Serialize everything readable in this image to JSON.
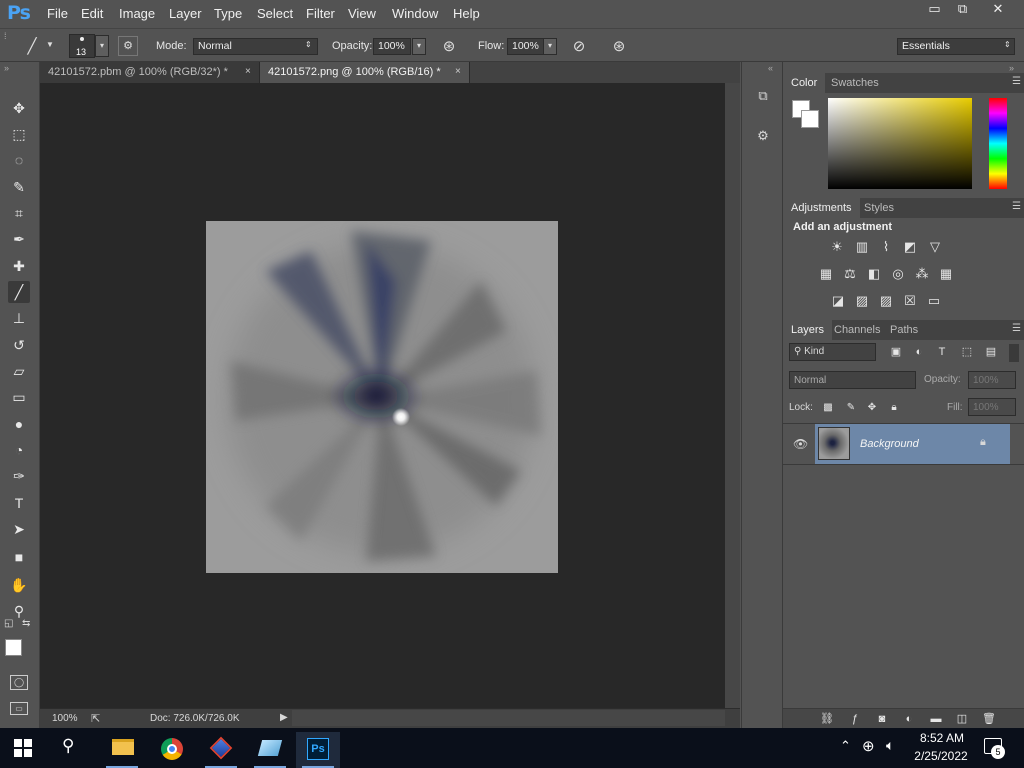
{
  "app": {
    "logo": "Ps"
  },
  "menu": [
    "File",
    "Edit",
    "Image",
    "Layer",
    "Type",
    "Select",
    "Filter",
    "View",
    "Window",
    "Help"
  ],
  "window_controls": {
    "minimize": "▭",
    "restore": "⧉",
    "close": "✕"
  },
  "options_bar": {
    "brush_size": "13",
    "mode_label": "Mode:",
    "mode_value": "Normal",
    "opacity_label": "Opacity:",
    "opacity_value": "100%",
    "flow_label": "Flow:",
    "flow_value": "100%",
    "workspace": "Essentials"
  },
  "doc_tabs": [
    {
      "label": "42101572.pbm @ 100% (RGB/32*) *",
      "close": "×",
      "active": false
    },
    {
      "label": "42101572.png @ 100% (RGB/16) *",
      "close": "×",
      "active": true
    }
  ],
  "tools": [
    {
      "name": "move-tool",
      "glyph": "✥"
    },
    {
      "name": "marquee-tool",
      "glyph": "⬚"
    },
    {
      "name": "lasso-tool",
      "glyph": "◌"
    },
    {
      "name": "quick-select-tool",
      "glyph": "✎"
    },
    {
      "name": "crop-tool",
      "glyph": "⌗"
    },
    {
      "name": "eyedropper-tool",
      "glyph": "✒"
    },
    {
      "name": "healing-brush-tool",
      "glyph": "✚"
    },
    {
      "name": "brush-tool",
      "glyph": "╱"
    },
    {
      "name": "clone-stamp-tool",
      "glyph": "⊥"
    },
    {
      "name": "history-brush-tool",
      "glyph": "↺"
    },
    {
      "name": "eraser-tool",
      "glyph": "▱"
    },
    {
      "name": "gradient-tool",
      "glyph": "▭"
    },
    {
      "name": "blur-tool",
      "glyph": "●"
    },
    {
      "name": "dodge-tool",
      "glyph": "◔"
    },
    {
      "name": "pen-tool",
      "glyph": "✑"
    },
    {
      "name": "type-tool",
      "glyph": "T"
    },
    {
      "name": "path-select-tool",
      "glyph": "➤"
    },
    {
      "name": "shape-tool",
      "glyph": "■"
    },
    {
      "name": "hand-tool",
      "glyph": "✋"
    },
    {
      "name": "zoom-tool",
      "glyph": "⚲"
    }
  ],
  "status": {
    "zoom": "100%",
    "doc_info": "Doc: 726.0K/726.0K"
  },
  "color_panel": {
    "tabs": [
      "Color",
      "Swatches"
    ]
  },
  "adjustments_panel": {
    "tabs": [
      "Adjustments",
      "Styles"
    ],
    "heading": "Add an adjustment"
  },
  "layers_panel": {
    "tabs": [
      "Layers",
      "Channels",
      "Paths"
    ],
    "filter_kind": "Kind",
    "blend_mode": "Normal",
    "opacity_label": "Opacity:",
    "opacity_value": "100%",
    "lock_label": "Lock:",
    "fill_label": "Fill:",
    "fill_value": "100%",
    "layers": [
      {
        "name": "Background",
        "visible": true,
        "locked": true
      }
    ]
  },
  "taskbar": {
    "time": "8:52 AM",
    "date": "2/25/2022",
    "notification_count": "5",
    "apps": [
      "file-explorer",
      "chrome",
      "app-3d-box",
      "app-notes",
      "photoshop"
    ]
  }
}
